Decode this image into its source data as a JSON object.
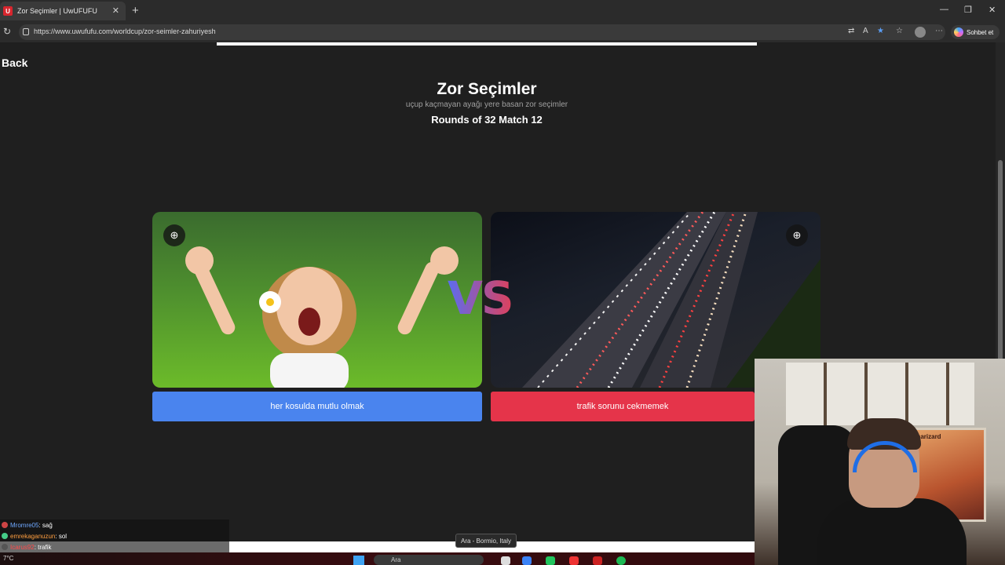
{
  "browser": {
    "tab_title": "Zor Seçimler | UwUFUFU",
    "favicon_letter": "U",
    "url": "https://www.uwufufu.com/worldcup/zor-seimler-zahuriyesh",
    "copilot_label": "Sohbet et"
  },
  "page": {
    "back_label": "Back",
    "title": "Zor Seçimler",
    "subtitle": "uçup kaçmayan ayağı yere basan zor seçimler",
    "round": "Rounds of 32 Match 12",
    "vs_text": "VS",
    "left_choice": "her kosulda mutlu olmak",
    "right_choice": "trafik sorunu cekmemek"
  },
  "chat": [
    {
      "user": "Mromre05",
      "text": ": sağ",
      "color": "#6fa8ff"
    },
    {
      "user": "emrekaganuzun",
      "text": ": sol",
      "color": "#ff9f40"
    },
    {
      "user": "Icarus92",
      "text": ": trafik",
      "color": "#ff4a4a"
    }
  ],
  "taskbar": {
    "temperature": "7°C",
    "search_placeholder": "Ara",
    "tooltip": "Ara - Bormio, Italy"
  },
  "webcam": {
    "poster_text": "k Charizard"
  },
  "colors": {
    "left_button": "#4a84ee",
    "right_button": "#e5344a",
    "background": "#1f1f1f"
  }
}
